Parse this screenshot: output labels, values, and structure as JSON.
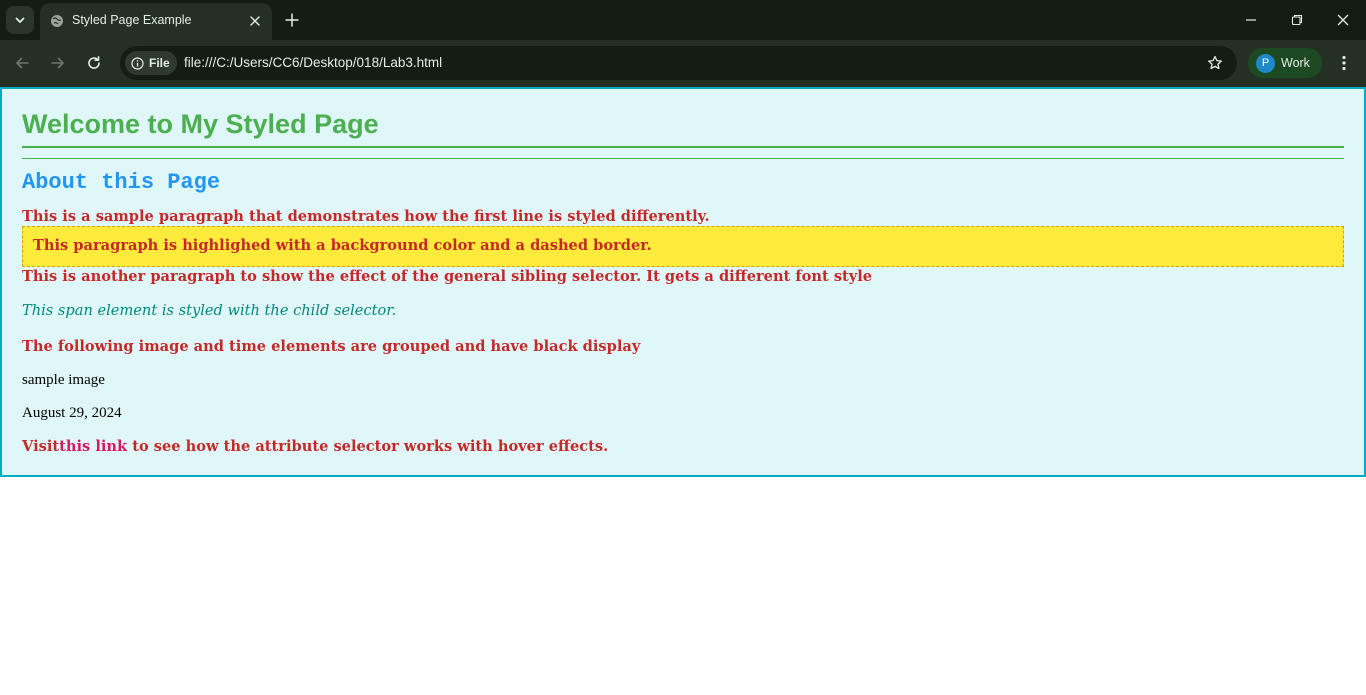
{
  "browser": {
    "tab": {
      "title": "Styled Page Example"
    },
    "address": {
      "chip_label": "File",
      "url": "file:///C:/Users/CC6/Desktop/018/Lab3.html"
    },
    "profile": {
      "initial": "P",
      "label": "Work"
    },
    "colors": {
      "tabbar_bg": "#141d14",
      "toolbar_bg": "#243024",
      "profile_bg": "#1d4a23"
    }
  },
  "page": {
    "heading": "Welcome to My Styled Page",
    "subheading": "About this Page",
    "paragraph_first": "This is a sample paragraph that demonstrates how the first line is styled differently.",
    "paragraph_highlighted": "This paragraph is highlighed with a background color and a dashed border.",
    "paragraph_sibling": "This is another paragraph to show the effect of the general sibling selector. It gets a different font style",
    "span_child": "This span element is styled with the child selector.",
    "paragraph_grouped": "The following image and time elements are grouped and have black display",
    "image_alt": "sample image",
    "time": "August 29, 2024",
    "link_paragraph": {
      "prefix": "Visit",
      "link_text": "this link",
      "suffix": " to see how the attribute selector works with hover effects."
    },
    "colors": {
      "background": "#e0f7fa",
      "border": "#00acc1",
      "heading": "#4caf50",
      "subheading": "#2196f3",
      "paragraph": "#c62828",
      "highlight_bg": "#ffeb3b",
      "span": "#00897b",
      "link": "#d81b60"
    }
  }
}
